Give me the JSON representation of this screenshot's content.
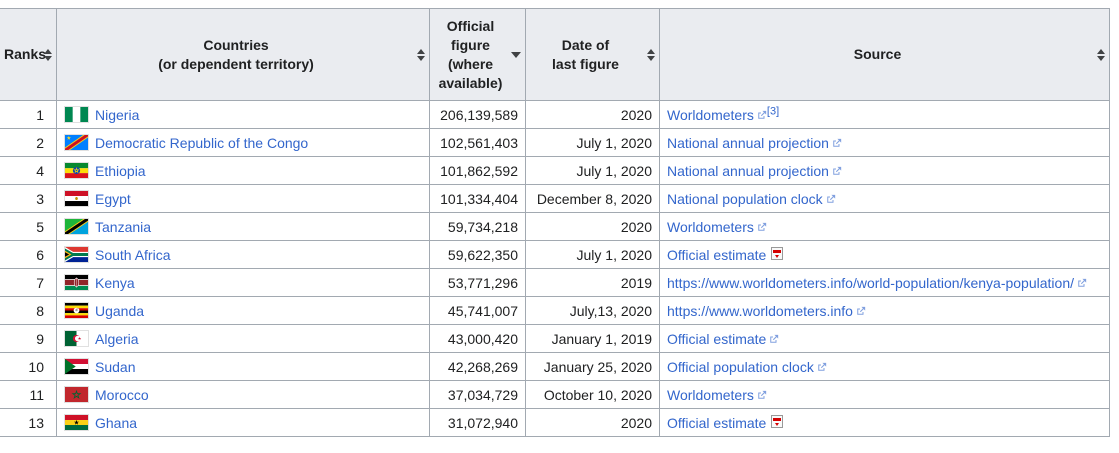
{
  "theme": {
    "link_color": "#3366cc",
    "header_background": "#eaecf0",
    "border_color": "#a2a9b1"
  },
  "table": {
    "columns": [
      {
        "id": "ranks",
        "label_lines": [
          "Ranks"
        ],
        "sort": "both"
      },
      {
        "id": "countries",
        "label_lines": [
          "Countries",
          "(or dependent territory)"
        ],
        "sort": "both"
      },
      {
        "id": "figure",
        "label_lines": [
          "Official",
          "figure",
          "(where",
          "available)"
        ],
        "sort": "desc"
      },
      {
        "id": "date",
        "label_lines": [
          "Date of",
          "last figure"
        ],
        "sort": "both"
      },
      {
        "id": "source",
        "label_lines": [
          "Source"
        ],
        "sort": "both"
      }
    ],
    "rows": [
      {
        "rank": "1",
        "country": "Nigeria",
        "flag": "nigeria",
        "figure": "206,139,589",
        "date": "2020",
        "source_text": "Worldometers",
        "source_icon": "external",
        "source_ref": "[3]"
      },
      {
        "rank": "2",
        "country": "Democratic Republic of the Congo",
        "flag": "dr-congo",
        "figure": "102,561,403",
        "date": "July 1, 2020",
        "source_text": "National annual projection",
        "source_icon": "external"
      },
      {
        "rank": "4",
        "country": "Ethiopia",
        "flag": "ethiopia",
        "figure": "101,862,592",
        "date": "July 1, 2020",
        "source_text": "National annual projection",
        "source_icon": "external"
      },
      {
        "rank": "3",
        "country": "Egypt",
        "flag": "egypt",
        "figure": "101,334,404",
        "date": "December 8, 2020",
        "source_text": "National population clock",
        "source_icon": "external"
      },
      {
        "rank": "5",
        "country": "Tanzania",
        "flag": "tanzania",
        "figure": "59,734,218",
        "date": "2020",
        "source_text": "Worldometers",
        "source_icon": "external"
      },
      {
        "rank": "6",
        "country": "South Africa",
        "flag": "south-africa",
        "figure": "59,622,350",
        "date": "July 1, 2020",
        "source_text": "Official estimate",
        "source_icon": "pdf"
      },
      {
        "rank": "7",
        "country": "Kenya",
        "flag": "kenya",
        "figure": "53,771,296",
        "date": "2019",
        "source_text": "https://www.worldometers.info/world-population/kenya-population/",
        "source_icon": "external"
      },
      {
        "rank": "8",
        "country": "Uganda",
        "flag": "uganda",
        "figure": "45,741,007",
        "date": "July,13, 2020",
        "source_text": "https://www.worldometers.info",
        "source_icon": "external"
      },
      {
        "rank": "9",
        "country": "Algeria",
        "flag": "algeria",
        "figure": "43,000,420",
        "date": "January 1, 2019",
        "source_text": "Official estimate",
        "source_icon": "external"
      },
      {
        "rank": "10",
        "country": "Sudan",
        "flag": "sudan",
        "figure": "42,268,269",
        "date": "January 25, 2020",
        "source_text": "Official population clock",
        "source_icon": "external"
      },
      {
        "rank": "11",
        "country": "Morocco",
        "flag": "morocco",
        "figure": "37,034,729",
        "date": "October 10, 2020",
        "source_text": "Worldometers",
        "source_icon": "external"
      },
      {
        "rank": "13",
        "country": "Ghana",
        "flag": "ghana",
        "figure": "31,072,940",
        "date": "2020",
        "source_text": "Official estimate",
        "source_icon": "pdf"
      }
    ]
  }
}
